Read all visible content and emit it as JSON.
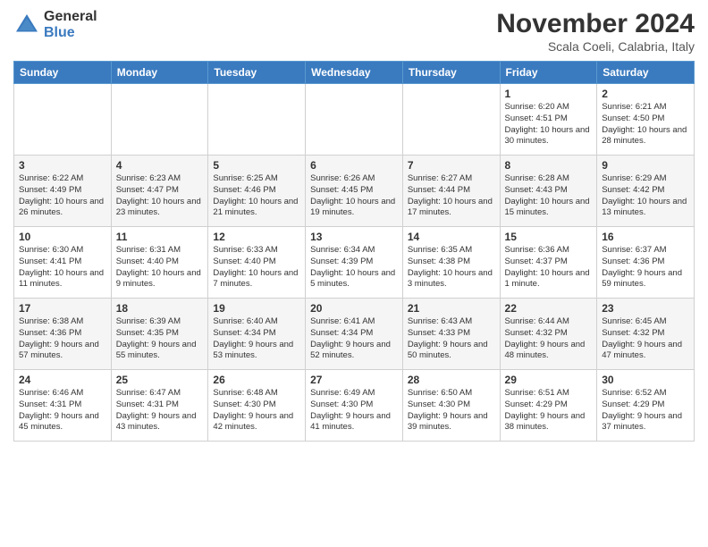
{
  "logo": {
    "general": "General",
    "blue": "Blue"
  },
  "header": {
    "month": "November 2024",
    "location": "Scala Coeli, Calabria, Italy"
  },
  "weekdays": [
    "Sunday",
    "Monday",
    "Tuesday",
    "Wednesday",
    "Thursday",
    "Friday",
    "Saturday"
  ],
  "weeks": [
    [
      {
        "day": "",
        "info": ""
      },
      {
        "day": "",
        "info": ""
      },
      {
        "day": "",
        "info": ""
      },
      {
        "day": "",
        "info": ""
      },
      {
        "day": "",
        "info": ""
      },
      {
        "day": "1",
        "info": "Sunrise: 6:20 AM\nSunset: 4:51 PM\nDaylight: 10 hours and 30 minutes."
      },
      {
        "day": "2",
        "info": "Sunrise: 6:21 AM\nSunset: 4:50 PM\nDaylight: 10 hours and 28 minutes."
      }
    ],
    [
      {
        "day": "3",
        "info": "Sunrise: 6:22 AM\nSunset: 4:49 PM\nDaylight: 10 hours and 26 minutes."
      },
      {
        "day": "4",
        "info": "Sunrise: 6:23 AM\nSunset: 4:47 PM\nDaylight: 10 hours and 23 minutes."
      },
      {
        "day": "5",
        "info": "Sunrise: 6:25 AM\nSunset: 4:46 PM\nDaylight: 10 hours and 21 minutes."
      },
      {
        "day": "6",
        "info": "Sunrise: 6:26 AM\nSunset: 4:45 PM\nDaylight: 10 hours and 19 minutes."
      },
      {
        "day": "7",
        "info": "Sunrise: 6:27 AM\nSunset: 4:44 PM\nDaylight: 10 hours and 17 minutes."
      },
      {
        "day": "8",
        "info": "Sunrise: 6:28 AM\nSunset: 4:43 PM\nDaylight: 10 hours and 15 minutes."
      },
      {
        "day": "9",
        "info": "Sunrise: 6:29 AM\nSunset: 4:42 PM\nDaylight: 10 hours and 13 minutes."
      }
    ],
    [
      {
        "day": "10",
        "info": "Sunrise: 6:30 AM\nSunset: 4:41 PM\nDaylight: 10 hours and 11 minutes."
      },
      {
        "day": "11",
        "info": "Sunrise: 6:31 AM\nSunset: 4:40 PM\nDaylight: 10 hours and 9 minutes."
      },
      {
        "day": "12",
        "info": "Sunrise: 6:33 AM\nSunset: 4:40 PM\nDaylight: 10 hours and 7 minutes."
      },
      {
        "day": "13",
        "info": "Sunrise: 6:34 AM\nSunset: 4:39 PM\nDaylight: 10 hours and 5 minutes."
      },
      {
        "day": "14",
        "info": "Sunrise: 6:35 AM\nSunset: 4:38 PM\nDaylight: 10 hours and 3 minutes."
      },
      {
        "day": "15",
        "info": "Sunrise: 6:36 AM\nSunset: 4:37 PM\nDaylight: 10 hours and 1 minute."
      },
      {
        "day": "16",
        "info": "Sunrise: 6:37 AM\nSunset: 4:36 PM\nDaylight: 9 hours and 59 minutes."
      }
    ],
    [
      {
        "day": "17",
        "info": "Sunrise: 6:38 AM\nSunset: 4:36 PM\nDaylight: 9 hours and 57 minutes."
      },
      {
        "day": "18",
        "info": "Sunrise: 6:39 AM\nSunset: 4:35 PM\nDaylight: 9 hours and 55 minutes."
      },
      {
        "day": "19",
        "info": "Sunrise: 6:40 AM\nSunset: 4:34 PM\nDaylight: 9 hours and 53 minutes."
      },
      {
        "day": "20",
        "info": "Sunrise: 6:41 AM\nSunset: 4:34 PM\nDaylight: 9 hours and 52 minutes."
      },
      {
        "day": "21",
        "info": "Sunrise: 6:43 AM\nSunset: 4:33 PM\nDaylight: 9 hours and 50 minutes."
      },
      {
        "day": "22",
        "info": "Sunrise: 6:44 AM\nSunset: 4:32 PM\nDaylight: 9 hours and 48 minutes."
      },
      {
        "day": "23",
        "info": "Sunrise: 6:45 AM\nSunset: 4:32 PM\nDaylight: 9 hours and 47 minutes."
      }
    ],
    [
      {
        "day": "24",
        "info": "Sunrise: 6:46 AM\nSunset: 4:31 PM\nDaylight: 9 hours and 45 minutes."
      },
      {
        "day": "25",
        "info": "Sunrise: 6:47 AM\nSunset: 4:31 PM\nDaylight: 9 hours and 43 minutes."
      },
      {
        "day": "26",
        "info": "Sunrise: 6:48 AM\nSunset: 4:30 PM\nDaylight: 9 hours and 42 minutes."
      },
      {
        "day": "27",
        "info": "Sunrise: 6:49 AM\nSunset: 4:30 PM\nDaylight: 9 hours and 41 minutes."
      },
      {
        "day": "28",
        "info": "Sunrise: 6:50 AM\nSunset: 4:30 PM\nDaylight: 9 hours and 39 minutes."
      },
      {
        "day": "29",
        "info": "Sunrise: 6:51 AM\nSunset: 4:29 PM\nDaylight: 9 hours and 38 minutes."
      },
      {
        "day": "30",
        "info": "Sunrise: 6:52 AM\nSunset: 4:29 PM\nDaylight: 9 hours and 37 minutes."
      }
    ]
  ]
}
